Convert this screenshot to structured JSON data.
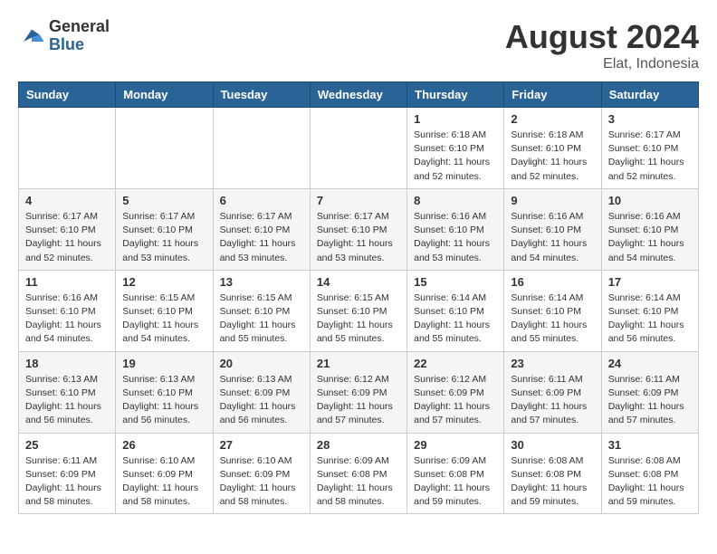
{
  "header": {
    "logo_general": "General",
    "logo_blue": "Blue",
    "month_year": "August 2024",
    "location": "Elat, Indonesia"
  },
  "weekdays": [
    "Sunday",
    "Monday",
    "Tuesday",
    "Wednesday",
    "Thursday",
    "Friday",
    "Saturday"
  ],
  "weeks": [
    [
      {
        "day": "",
        "info": ""
      },
      {
        "day": "",
        "info": ""
      },
      {
        "day": "",
        "info": ""
      },
      {
        "day": "",
        "info": ""
      },
      {
        "day": "1",
        "info": "Sunrise: 6:18 AM\nSunset: 6:10 PM\nDaylight: 11 hours\nand 52 minutes."
      },
      {
        "day": "2",
        "info": "Sunrise: 6:18 AM\nSunset: 6:10 PM\nDaylight: 11 hours\nand 52 minutes."
      },
      {
        "day": "3",
        "info": "Sunrise: 6:17 AM\nSunset: 6:10 PM\nDaylight: 11 hours\nand 52 minutes."
      }
    ],
    [
      {
        "day": "4",
        "info": "Sunrise: 6:17 AM\nSunset: 6:10 PM\nDaylight: 11 hours\nand 52 minutes."
      },
      {
        "day": "5",
        "info": "Sunrise: 6:17 AM\nSunset: 6:10 PM\nDaylight: 11 hours\nand 53 minutes."
      },
      {
        "day": "6",
        "info": "Sunrise: 6:17 AM\nSunset: 6:10 PM\nDaylight: 11 hours\nand 53 minutes."
      },
      {
        "day": "7",
        "info": "Sunrise: 6:17 AM\nSunset: 6:10 PM\nDaylight: 11 hours\nand 53 minutes."
      },
      {
        "day": "8",
        "info": "Sunrise: 6:16 AM\nSunset: 6:10 PM\nDaylight: 11 hours\nand 53 minutes."
      },
      {
        "day": "9",
        "info": "Sunrise: 6:16 AM\nSunset: 6:10 PM\nDaylight: 11 hours\nand 54 minutes."
      },
      {
        "day": "10",
        "info": "Sunrise: 6:16 AM\nSunset: 6:10 PM\nDaylight: 11 hours\nand 54 minutes."
      }
    ],
    [
      {
        "day": "11",
        "info": "Sunrise: 6:16 AM\nSunset: 6:10 PM\nDaylight: 11 hours\nand 54 minutes."
      },
      {
        "day": "12",
        "info": "Sunrise: 6:15 AM\nSunset: 6:10 PM\nDaylight: 11 hours\nand 54 minutes."
      },
      {
        "day": "13",
        "info": "Sunrise: 6:15 AM\nSunset: 6:10 PM\nDaylight: 11 hours\nand 55 minutes."
      },
      {
        "day": "14",
        "info": "Sunrise: 6:15 AM\nSunset: 6:10 PM\nDaylight: 11 hours\nand 55 minutes."
      },
      {
        "day": "15",
        "info": "Sunrise: 6:14 AM\nSunset: 6:10 PM\nDaylight: 11 hours\nand 55 minutes."
      },
      {
        "day": "16",
        "info": "Sunrise: 6:14 AM\nSunset: 6:10 PM\nDaylight: 11 hours\nand 55 minutes."
      },
      {
        "day": "17",
        "info": "Sunrise: 6:14 AM\nSunset: 6:10 PM\nDaylight: 11 hours\nand 56 minutes."
      }
    ],
    [
      {
        "day": "18",
        "info": "Sunrise: 6:13 AM\nSunset: 6:10 PM\nDaylight: 11 hours\nand 56 minutes."
      },
      {
        "day": "19",
        "info": "Sunrise: 6:13 AM\nSunset: 6:10 PM\nDaylight: 11 hours\nand 56 minutes."
      },
      {
        "day": "20",
        "info": "Sunrise: 6:13 AM\nSunset: 6:09 PM\nDaylight: 11 hours\nand 56 minutes."
      },
      {
        "day": "21",
        "info": "Sunrise: 6:12 AM\nSunset: 6:09 PM\nDaylight: 11 hours\nand 57 minutes."
      },
      {
        "day": "22",
        "info": "Sunrise: 6:12 AM\nSunset: 6:09 PM\nDaylight: 11 hours\nand 57 minutes."
      },
      {
        "day": "23",
        "info": "Sunrise: 6:11 AM\nSunset: 6:09 PM\nDaylight: 11 hours\nand 57 minutes."
      },
      {
        "day": "24",
        "info": "Sunrise: 6:11 AM\nSunset: 6:09 PM\nDaylight: 11 hours\nand 57 minutes."
      }
    ],
    [
      {
        "day": "25",
        "info": "Sunrise: 6:11 AM\nSunset: 6:09 PM\nDaylight: 11 hours\nand 58 minutes."
      },
      {
        "day": "26",
        "info": "Sunrise: 6:10 AM\nSunset: 6:09 PM\nDaylight: 11 hours\nand 58 minutes."
      },
      {
        "day": "27",
        "info": "Sunrise: 6:10 AM\nSunset: 6:09 PM\nDaylight: 11 hours\nand 58 minutes."
      },
      {
        "day": "28",
        "info": "Sunrise: 6:09 AM\nSunset: 6:08 PM\nDaylight: 11 hours\nand 58 minutes."
      },
      {
        "day": "29",
        "info": "Sunrise: 6:09 AM\nSunset: 6:08 PM\nDaylight: 11 hours\nand 59 minutes."
      },
      {
        "day": "30",
        "info": "Sunrise: 6:08 AM\nSunset: 6:08 PM\nDaylight: 11 hours\nand 59 minutes."
      },
      {
        "day": "31",
        "info": "Sunrise: 6:08 AM\nSunset: 6:08 PM\nDaylight: 11 hours\nand 59 minutes."
      }
    ]
  ]
}
